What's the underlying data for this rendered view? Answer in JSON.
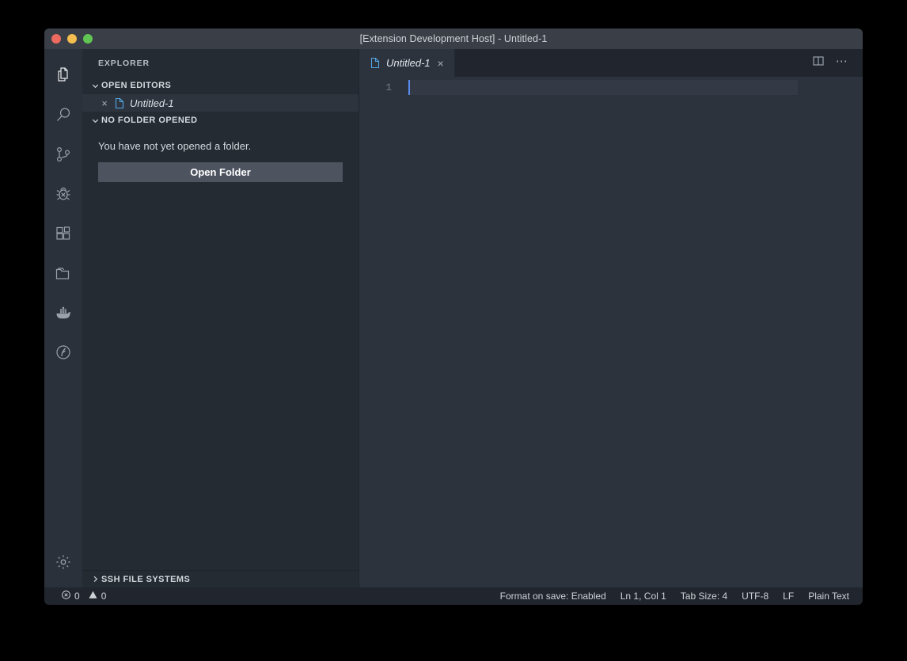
{
  "window": {
    "title": "[Extension Development Host] - Untitled-1",
    "traffic_lights": [
      {
        "name": "close",
        "color": "#ec6a5f"
      },
      {
        "name": "minimize",
        "color": "#f5bf4f"
      },
      {
        "name": "maximize",
        "color": "#61c554"
      }
    ]
  },
  "activity_bar": {
    "items": [
      {
        "icon": "files-explorer-icon",
        "label": "Explorer",
        "active": true
      },
      {
        "icon": "search-icon",
        "label": "Search",
        "active": false
      },
      {
        "icon": "source-control-icon",
        "label": "Source Control",
        "active": false
      },
      {
        "icon": "run-and-debug-icon",
        "label": "Run and Debug",
        "active": false
      },
      {
        "icon": "extensions-icon",
        "label": "Extensions",
        "active": false
      },
      {
        "icon": "folder-icon",
        "label": "Remote File Systems",
        "active": false
      },
      {
        "icon": "docker-whale-icon",
        "label": "Docker",
        "active": false
      },
      {
        "icon": "remote-explorer-icon",
        "label": "Remote Explorer",
        "active": false
      }
    ],
    "bottom_items": [
      {
        "icon": "gear-icon",
        "label": "Manage"
      }
    ]
  },
  "sidebar": {
    "title": "EXPLORER",
    "open_editors": {
      "header": "OPEN EDITORS",
      "expanded": true,
      "items": [
        {
          "name": "Untitled-1",
          "icon": "file-icon",
          "close": "×",
          "selected": true
        }
      ]
    },
    "no_folder": {
      "header": "NO FOLDER OPENED",
      "expanded": true,
      "message": "You have not yet opened a folder.",
      "open_folder_label": "Open Folder"
    },
    "ssh_file_systems": {
      "header": "SSH FILE SYSTEMS",
      "expanded": false
    }
  },
  "editor": {
    "tabs": [
      {
        "label": "Untitled-1",
        "icon": "file-icon",
        "close": "×",
        "active": true
      }
    ],
    "actions": [
      {
        "icon": "split-editor-icon",
        "label": "Split Editor"
      },
      {
        "icon": "more-actions-icon",
        "label": "…"
      }
    ],
    "line_numbers": [
      "1"
    ],
    "content": [
      ""
    ],
    "cursor": {
      "line": 1,
      "column": 1
    }
  },
  "status_bar": {
    "left": [
      {
        "icon": "error-icon",
        "value": "0",
        "name": "error-count"
      },
      {
        "icon": "warning-icon",
        "value": "0",
        "name": "warning-count"
      }
    ],
    "right": [
      {
        "label": "Format on save: Enabled",
        "name": "format-on-save"
      },
      {
        "label": "Ln 1, Col 1",
        "name": "cursor-position"
      },
      {
        "label": "Tab Size: 4",
        "name": "tab-size"
      },
      {
        "label": "UTF-8",
        "name": "encoding"
      },
      {
        "label": "LF",
        "name": "eol"
      },
      {
        "label": "Plain Text",
        "name": "language-mode"
      }
    ]
  },
  "colors": {
    "accent": "#5a8cf0",
    "file_icon": "#53a7e8",
    "background": "#252b33",
    "editor_background": "#2d333d",
    "titlebar": "#3a3f47",
    "statusbar": "#21262e"
  }
}
